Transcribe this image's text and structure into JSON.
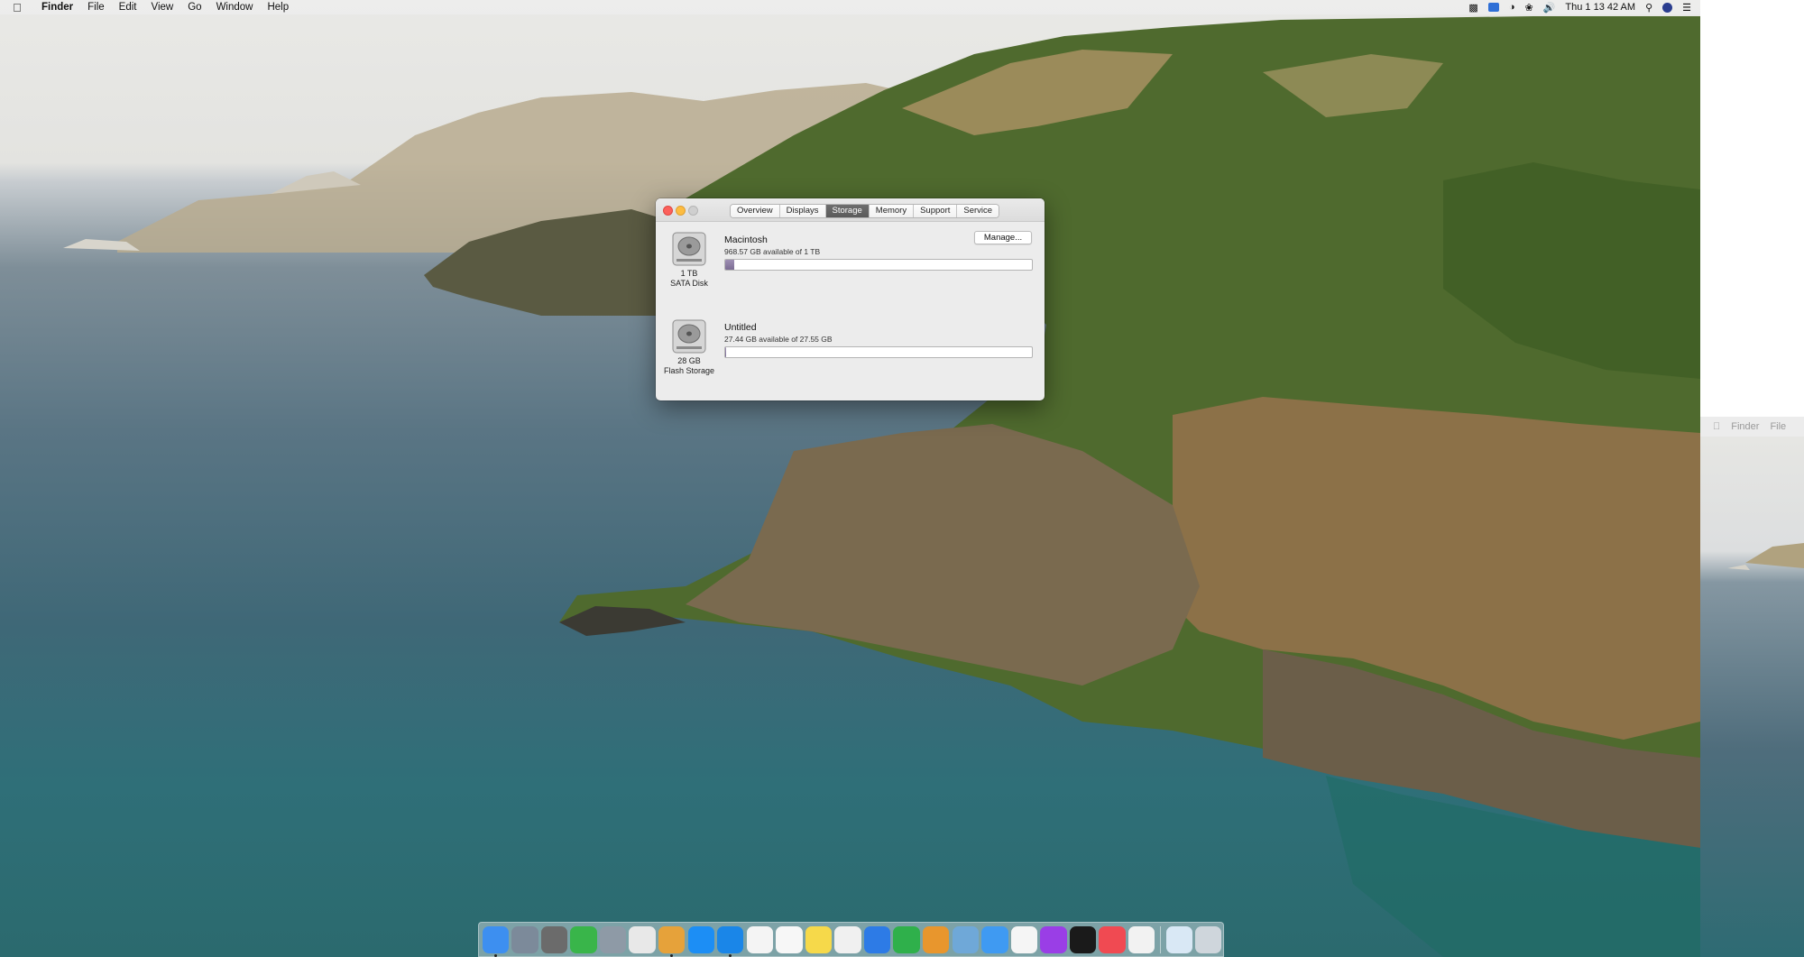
{
  "menubar": {
    "apple_icon": "apple-icon",
    "app_name": "Finder",
    "items": [
      "File",
      "Edit",
      "View",
      "Go",
      "Window",
      "Help"
    ],
    "clock": "Thu 1 13 42 AM",
    "status_icons": [
      "control-strip-icon",
      "display-icon",
      "airdrop-icon",
      "wifi-icon",
      "volume-icon",
      "search-icon",
      "user-icon",
      "menu-list-icon"
    ]
  },
  "side_strip": {
    "items": [
      "Finder",
      "File"
    ]
  },
  "window": {
    "tabs": [
      "Overview",
      "Displays",
      "Storage",
      "Memory",
      "Support",
      "Service"
    ],
    "active_tab": "Storage",
    "disks": [
      {
        "name": "Macintosh",
        "available": "968.57 GB available of 1 TB",
        "capacity": "1 TB",
        "kind": "SATA Disk",
        "used_fraction": 0.03,
        "manage_label": "Manage..."
      },
      {
        "name": "Untitled",
        "available": "27.44 GB available of 27.55 GB",
        "capacity": "28 GB",
        "kind": "Flash Storage",
        "used_fraction": 0.004
      }
    ]
  },
  "dock": {
    "apps": [
      {
        "name": "finder-icon",
        "color": "#3d8ff0",
        "running": true
      },
      {
        "name": "launchpad-icon",
        "color": "#7c8a9a",
        "running": false
      },
      {
        "name": "system-preferences-icon",
        "color": "#6b6b6b",
        "running": false
      },
      {
        "name": "find-my-icon",
        "color": "#39b54a",
        "running": false
      },
      {
        "name": "disk-utility-icon",
        "color": "#8e9aa6",
        "running": false
      },
      {
        "name": "screenshot-icon",
        "color": "#e8e8e8",
        "running": false
      },
      {
        "name": "home-folder-icon",
        "color": "#e6a23a",
        "running": true
      },
      {
        "name": "app-store-icon",
        "color": "#1c8ef5",
        "running": false
      },
      {
        "name": "safari-icon",
        "color": "#1a86e8",
        "running": true
      },
      {
        "name": "calendar-icon",
        "color": "#f4f4f4",
        "running": false
      },
      {
        "name": "reminders-icon",
        "color": "#f7f7f7",
        "running": false
      },
      {
        "name": "notes-icon",
        "color": "#f6d94a",
        "running": false
      },
      {
        "name": "textedit-icon",
        "color": "#f0f0f0",
        "running": false
      },
      {
        "name": "keynote-icon",
        "color": "#2d7be6",
        "running": false
      },
      {
        "name": "numbers-icon",
        "color": "#2fb04b",
        "running": false
      },
      {
        "name": "pages-icon",
        "color": "#e8962d",
        "running": false
      },
      {
        "name": "preview-icon",
        "color": "#6fa8d8",
        "running": false
      },
      {
        "name": "messages-icon",
        "color": "#3f9af2",
        "running": false
      },
      {
        "name": "music-icon",
        "color": "#f5f5f5",
        "running": false
      },
      {
        "name": "podcasts-icon",
        "color": "#9a3ee6",
        "running": false
      },
      {
        "name": "tv-icon",
        "color": "#1a1a1a",
        "running": false
      },
      {
        "name": "news-icon",
        "color": "#f04a52",
        "running": false
      },
      {
        "name": "photos-icon",
        "color": "#f2f2f2",
        "running": false
      }
    ],
    "trailing": [
      {
        "name": "downloads-folder-icon",
        "color": "#d9e8f5"
      },
      {
        "name": "trash-icon",
        "color": "#cfd6dc"
      }
    ]
  }
}
